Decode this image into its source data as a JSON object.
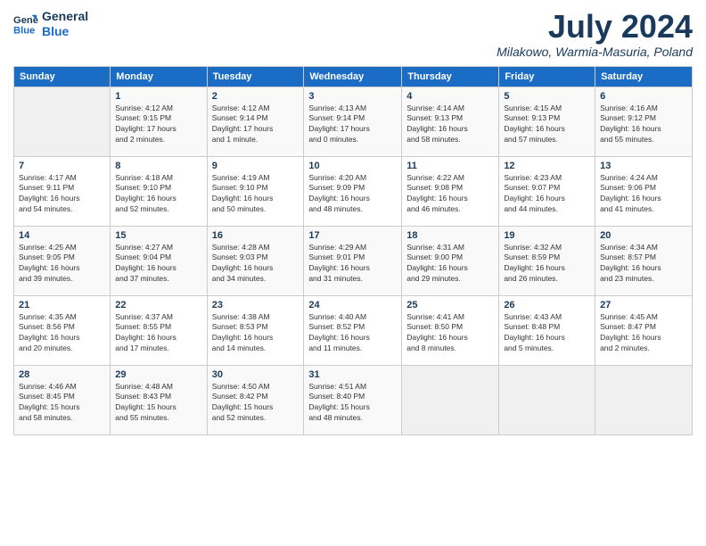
{
  "logo": {
    "line1": "General",
    "line2": "Blue"
  },
  "title": "July 2024",
  "location": "Milakowo, Warmia-Masuria, Poland",
  "days_header": [
    "Sunday",
    "Monday",
    "Tuesday",
    "Wednesday",
    "Thursday",
    "Friday",
    "Saturday"
  ],
  "weeks": [
    [
      {
        "num": "",
        "info": ""
      },
      {
        "num": "1",
        "info": "Sunrise: 4:12 AM\nSunset: 9:15 PM\nDaylight: 17 hours\nand 2 minutes."
      },
      {
        "num": "2",
        "info": "Sunrise: 4:12 AM\nSunset: 9:14 PM\nDaylight: 17 hours\nand 1 minute."
      },
      {
        "num": "3",
        "info": "Sunrise: 4:13 AM\nSunset: 9:14 PM\nDaylight: 17 hours\nand 0 minutes."
      },
      {
        "num": "4",
        "info": "Sunrise: 4:14 AM\nSunset: 9:13 PM\nDaylight: 16 hours\nand 58 minutes."
      },
      {
        "num": "5",
        "info": "Sunrise: 4:15 AM\nSunset: 9:13 PM\nDaylight: 16 hours\nand 57 minutes."
      },
      {
        "num": "6",
        "info": "Sunrise: 4:16 AM\nSunset: 9:12 PM\nDaylight: 16 hours\nand 55 minutes."
      }
    ],
    [
      {
        "num": "7",
        "info": "Sunrise: 4:17 AM\nSunset: 9:11 PM\nDaylight: 16 hours\nand 54 minutes."
      },
      {
        "num": "8",
        "info": "Sunrise: 4:18 AM\nSunset: 9:10 PM\nDaylight: 16 hours\nand 52 minutes."
      },
      {
        "num": "9",
        "info": "Sunrise: 4:19 AM\nSunset: 9:10 PM\nDaylight: 16 hours\nand 50 minutes."
      },
      {
        "num": "10",
        "info": "Sunrise: 4:20 AM\nSunset: 9:09 PM\nDaylight: 16 hours\nand 48 minutes."
      },
      {
        "num": "11",
        "info": "Sunrise: 4:22 AM\nSunset: 9:08 PM\nDaylight: 16 hours\nand 46 minutes."
      },
      {
        "num": "12",
        "info": "Sunrise: 4:23 AM\nSunset: 9:07 PM\nDaylight: 16 hours\nand 44 minutes."
      },
      {
        "num": "13",
        "info": "Sunrise: 4:24 AM\nSunset: 9:06 PM\nDaylight: 16 hours\nand 41 minutes."
      }
    ],
    [
      {
        "num": "14",
        "info": "Sunrise: 4:25 AM\nSunset: 9:05 PM\nDaylight: 16 hours\nand 39 minutes."
      },
      {
        "num": "15",
        "info": "Sunrise: 4:27 AM\nSunset: 9:04 PM\nDaylight: 16 hours\nand 37 minutes."
      },
      {
        "num": "16",
        "info": "Sunrise: 4:28 AM\nSunset: 9:03 PM\nDaylight: 16 hours\nand 34 minutes."
      },
      {
        "num": "17",
        "info": "Sunrise: 4:29 AM\nSunset: 9:01 PM\nDaylight: 16 hours\nand 31 minutes."
      },
      {
        "num": "18",
        "info": "Sunrise: 4:31 AM\nSunset: 9:00 PM\nDaylight: 16 hours\nand 29 minutes."
      },
      {
        "num": "19",
        "info": "Sunrise: 4:32 AM\nSunset: 8:59 PM\nDaylight: 16 hours\nand 26 minutes."
      },
      {
        "num": "20",
        "info": "Sunrise: 4:34 AM\nSunset: 8:57 PM\nDaylight: 16 hours\nand 23 minutes."
      }
    ],
    [
      {
        "num": "21",
        "info": "Sunrise: 4:35 AM\nSunset: 8:56 PM\nDaylight: 16 hours\nand 20 minutes."
      },
      {
        "num": "22",
        "info": "Sunrise: 4:37 AM\nSunset: 8:55 PM\nDaylight: 16 hours\nand 17 minutes."
      },
      {
        "num": "23",
        "info": "Sunrise: 4:38 AM\nSunset: 8:53 PM\nDaylight: 16 hours\nand 14 minutes."
      },
      {
        "num": "24",
        "info": "Sunrise: 4:40 AM\nSunset: 8:52 PM\nDaylight: 16 hours\nand 11 minutes."
      },
      {
        "num": "25",
        "info": "Sunrise: 4:41 AM\nSunset: 8:50 PM\nDaylight: 16 hours\nand 8 minutes."
      },
      {
        "num": "26",
        "info": "Sunrise: 4:43 AM\nSunset: 8:48 PM\nDaylight: 16 hours\nand 5 minutes."
      },
      {
        "num": "27",
        "info": "Sunrise: 4:45 AM\nSunset: 8:47 PM\nDaylight: 16 hours\nand 2 minutes."
      }
    ],
    [
      {
        "num": "28",
        "info": "Sunrise: 4:46 AM\nSunset: 8:45 PM\nDaylight: 15 hours\nand 58 minutes."
      },
      {
        "num": "29",
        "info": "Sunrise: 4:48 AM\nSunset: 8:43 PM\nDaylight: 15 hours\nand 55 minutes."
      },
      {
        "num": "30",
        "info": "Sunrise: 4:50 AM\nSunset: 8:42 PM\nDaylight: 15 hours\nand 52 minutes."
      },
      {
        "num": "31",
        "info": "Sunrise: 4:51 AM\nSunset: 8:40 PM\nDaylight: 15 hours\nand 48 minutes."
      },
      {
        "num": "",
        "info": ""
      },
      {
        "num": "",
        "info": ""
      },
      {
        "num": "",
        "info": ""
      }
    ]
  ]
}
